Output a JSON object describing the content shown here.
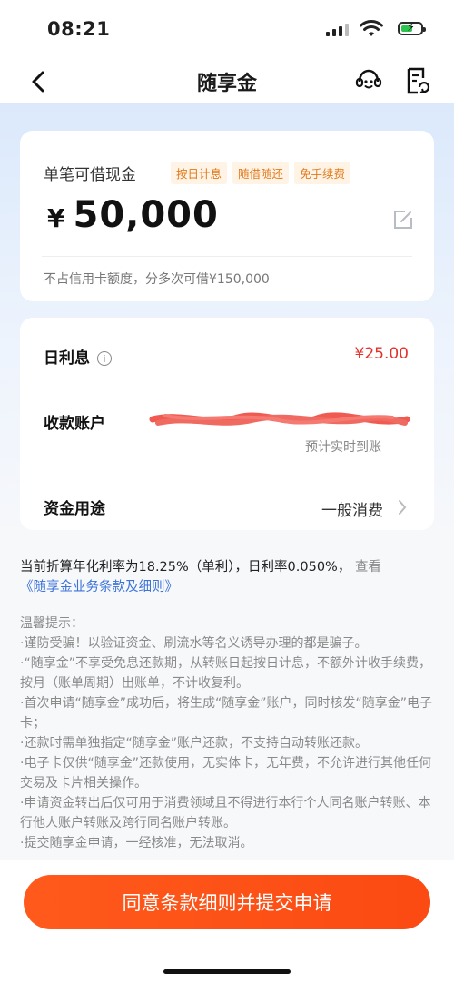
{
  "status_bar": {
    "time": "08:21"
  },
  "nav": {
    "title": "随享金"
  },
  "loan_card": {
    "label": "单笔可借现金",
    "tags": [
      "按日计息",
      "随借随还",
      "免手续费"
    ],
    "currency": "¥",
    "amount": "50,000",
    "note": "不占信用卡额度，分多次可借¥150,000"
  },
  "detail_card": {
    "interest_label": "日利息",
    "interest_value": "¥25.00",
    "account_label": "收款账户",
    "account_note": "预计实时到账",
    "usage_label": "资金用途",
    "usage_value": "一般消费"
  },
  "rate_info": {
    "text": "当前折算年化利率为18.25%（单利），日利率0.050%，",
    "view": "查看",
    "link": "《随享金业务条款及细则》"
  },
  "tips": {
    "title": "温馨提示：",
    "items": [
      "·谨防受骗！以验证资金、刷流水等名义诱导办理的都是骗子。",
      "·“随享金”不享受免息还款期，从转账日起按日计息，不额外计收手续费，按月（账单周期）出账单，不计收复利。",
      "·首次申请“随享金”成功后，将生成“随享金”账户，同时核发“随享金”电子卡；",
      "·还款时需单独指定“随享金”账户还款，不支持自动转账还款。",
      "·电子卡仅供“随享金”还款使用，无实体卡，无年费，不允许进行其他任何交易及卡片相关操作。",
      "·申请资金转出后仅可用于消费领域且不得进行本行个人同名账户转账、本行他人账户转账及跨行同名账户转账。",
      "·提交随享金申请，一经核准，无法取消。"
    ]
  },
  "submit": {
    "label": "同意条款细则并提交申请"
  },
  "colors": {
    "accent": "#fb4a12",
    "amount_red": "#e4312b",
    "link_blue": "#3b73d9",
    "tag_orange": "#e07a1a"
  }
}
